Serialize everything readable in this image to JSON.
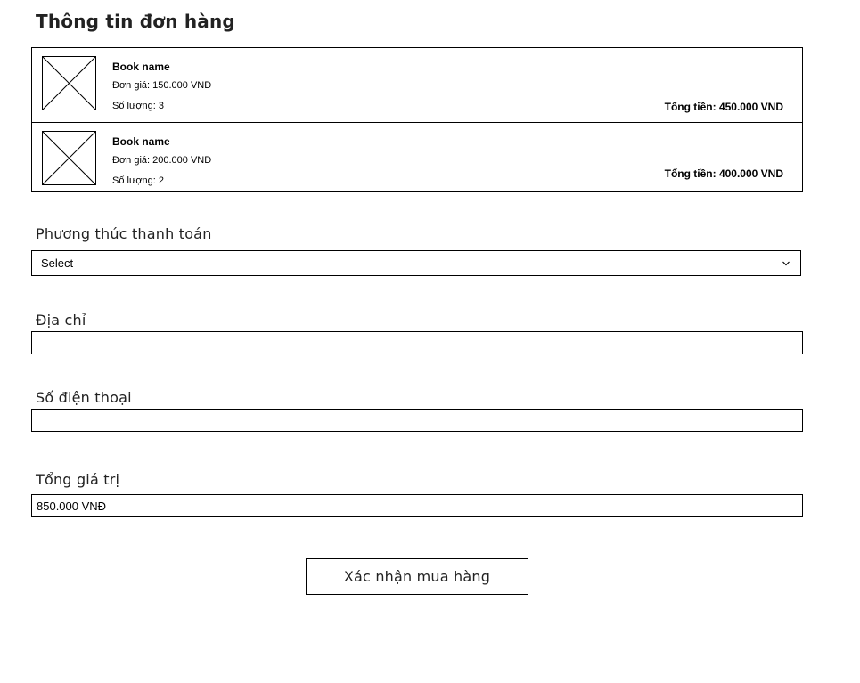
{
  "page": {
    "title": "Thông tin đơn hàng"
  },
  "order_items": [
    {
      "book_name": "Book name",
      "unit_price": "Đơn giá: 150.000 VND",
      "quantity": "Số lượng:  3",
      "total": "Tổng tiền: 450.000 VND",
      "image_icon": "image-placeholder-icon"
    },
    {
      "book_name": "Book name",
      "unit_price": "Đơn giá: 200.000 VND",
      "quantity": "Số lượng: 2",
      "total": "Tổng tiền: 400.000 VND",
      "image_icon": "image-placeholder-icon"
    }
  ],
  "payment": {
    "label": "Phương thức thanh toán",
    "selected": "Select",
    "icon": "chevron-down-icon"
  },
  "address": {
    "label": "Địa chỉ",
    "value": ""
  },
  "phone": {
    "label": "Số điện thoại",
    "value": ""
  },
  "grand_total": {
    "label": "Tổng giá trị",
    "value": "850.000 VNĐ"
  },
  "actions": {
    "confirm_label": "Xác nhận mua hàng"
  }
}
